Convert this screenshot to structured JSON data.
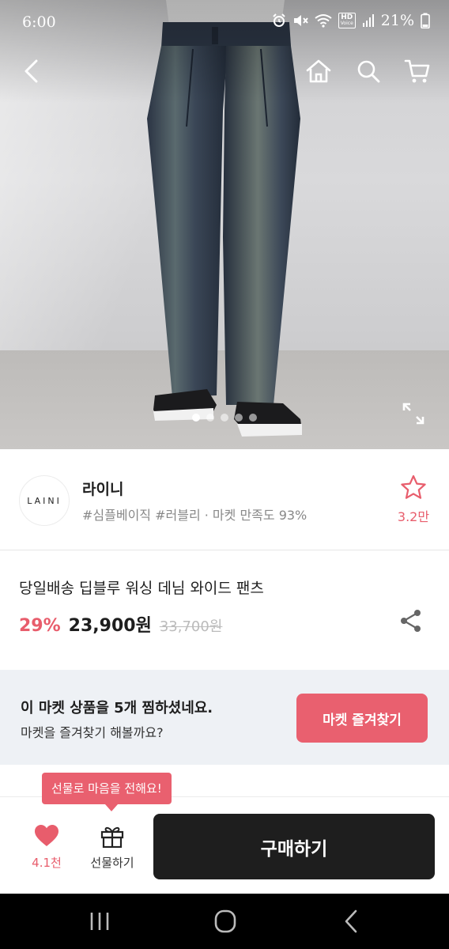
{
  "status_bar": {
    "time": "6:00",
    "battery": "21%",
    "icons": [
      "alarm-icon",
      "mute-icon",
      "wifi-icon",
      "hd-voice-icon",
      "signal-icon",
      "battery-icon"
    ],
    "hd_label": "HD",
    "voice_label": "Voice"
  },
  "top_nav": {
    "icons": [
      "back-icon",
      "home-icon",
      "search-icon",
      "cart-icon"
    ]
  },
  "carousel": {
    "slide_count": 5,
    "active_index": 0
  },
  "store": {
    "logo_text": "LAINI",
    "name": "라이니",
    "tags": "#심플베이직 #러블리 · 마켓 만족도 93%",
    "favorite_count": "3.2만"
  },
  "product": {
    "title": "당일배송 딥블루 워싱 데님 와이드 팬츠",
    "discount": "29%",
    "price": "23,900원",
    "original_price": "33,700원"
  },
  "promo": {
    "line1": "이 마켓 상품을 5개 찜하셨네요.",
    "line2": "마켓을 즐겨찾기 해볼까요?",
    "button_label": "마켓 즐겨찾기"
  },
  "tooltip": {
    "text": "선물로 마음을 전해요!"
  },
  "action_bar": {
    "like_count": "4.1천",
    "gift_label": "선물하기",
    "buy_label": "구매하기"
  },
  "colors": {
    "accent": "#e9606f",
    "dark_button": "#1e1e1e",
    "promo_bg": "#eef1f5"
  }
}
